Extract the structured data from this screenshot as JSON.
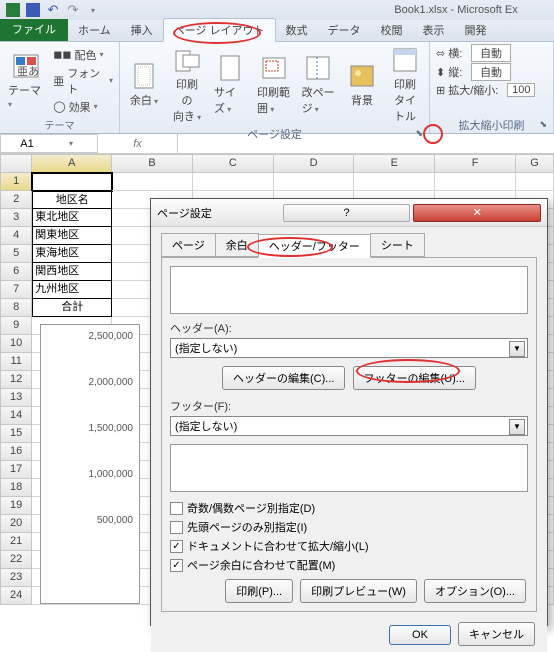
{
  "title": "Book1.xlsx - Microsoft Ex",
  "ribbon_tabs": {
    "file": "ファイル",
    "home": "ホーム",
    "insert": "挿入",
    "page_layout": "ページ レイアウト",
    "formulas": "数式",
    "data": "データ",
    "review": "校閲",
    "view": "表示",
    "developer": "開発"
  },
  "ribbon_groups": {
    "themes": {
      "label": "テーマ",
      "themes": "テーマ",
      "colors": "配色",
      "fonts": "フォント",
      "effects": "効果"
    },
    "page_setup": {
      "label": "ページ設定",
      "margins": "余白",
      "orientation": "印刷の\n向き",
      "size": "サイズ",
      "print_area": "印刷範囲",
      "breaks": "改ページ",
      "background": "背景",
      "print_titles": "印刷\nタイトル"
    },
    "scale": {
      "label": "拡大縮小印刷",
      "width": "横:",
      "height": "縦:",
      "scale": "拡大/縮小:",
      "auto1": "自動",
      "auto2": "自動",
      "pct": "100"
    }
  },
  "namebox": "A1",
  "columns": [
    "A",
    "B",
    "C",
    "D",
    "E",
    "F",
    "G"
  ],
  "rows": [
    1,
    2,
    3,
    4,
    5,
    6,
    7,
    8,
    9,
    10,
    11,
    12,
    13,
    14,
    15,
    16,
    17,
    18,
    19,
    20,
    21,
    22,
    23,
    24
  ],
  "cells": {
    "A2": "地区名",
    "A3": "東北地区",
    "A4": "関東地区",
    "A5": "東海地区",
    "A6": "関西地区",
    "A7": "九州地区",
    "A8": "合計"
  },
  "chart_data": {
    "type": "bar",
    "y_ticks": [
      "2,500,000",
      "2,000,000",
      "1,500,000",
      "1,000,000",
      "500,000"
    ]
  },
  "dialog": {
    "title": "ページ設定",
    "tabs": {
      "page": "ページ",
      "margins": "余白",
      "header_footer": "ヘッダー/フッター",
      "sheet": "シート"
    },
    "header_label": "ヘッダー(A):",
    "header_value": "(指定しない)",
    "edit_header": "ヘッダーの編集(C)...",
    "edit_footer": "フッターの編集(U)...",
    "footer_label": "フッター(F):",
    "footer_value": "(指定しない)",
    "chk_odd_even": "奇数/偶数ページ別指定(D)",
    "chk_first": "先頭ページのみ別指定(I)",
    "chk_scale": "ドキュメントに合わせて拡大/縮小(L)",
    "chk_align": "ページ余白に合わせて配置(M)",
    "btn_print": "印刷(P)...",
    "btn_preview": "印刷プレビュー(W)",
    "btn_options": "オプション(O)...",
    "btn_ok": "OK",
    "btn_cancel": "キャンセル"
  }
}
